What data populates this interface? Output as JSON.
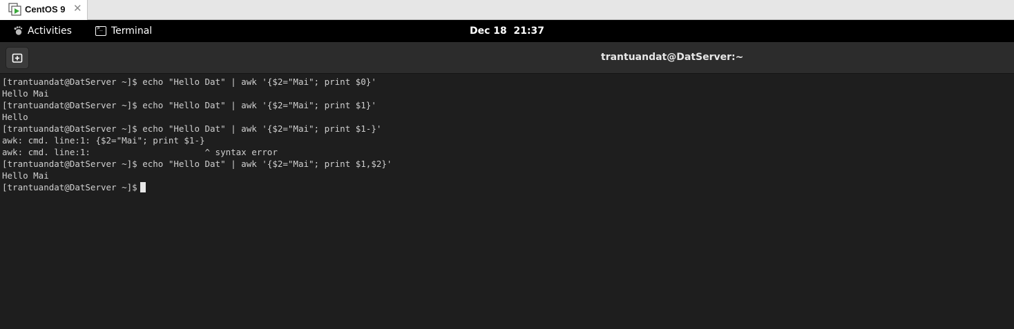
{
  "host": {
    "tab_label": "CentOS 9",
    "close_glyph": "✕"
  },
  "topbar": {
    "activities_label": "Activities",
    "app_label": "Terminal",
    "clock": "Dec 18  21:37"
  },
  "terminal": {
    "title": "trantuandat@DatServer:~",
    "prompt": "[trantuandat@DatServer ~]$",
    "lines": [
      "[trantuandat@DatServer ~]$ echo \"Hello Dat\" | awk '{$2=\"Mai\"; print $0}'",
      "Hello Mai",
      "[trantuandat@DatServer ~]$ echo \"Hello Dat\" | awk '{$2=\"Mai\"; print $1}'",
      "Hello",
      "[trantuandat@DatServer ~]$ echo \"Hello Dat\" | awk '{$2=\"Mai\"; print $1-}'",
      "awk: cmd. line:1: {$2=\"Mai\"; print $1-}",
      "awk: cmd. line:1:                      ^ syntax error",
      "[trantuandat@DatServer ~]$ echo \"Hello Dat\" | awk '{$2=\"Mai\"; print $1,$2}'",
      "Hello Mai"
    ]
  },
  "colors": {
    "terminal_bg": "#1e1e1e",
    "terminal_fg": "#d0d0d0",
    "topbar_bg": "#000000",
    "header_bg": "#2c2c2c"
  },
  "icons": {
    "vm": "vm-window-icon",
    "activities": "gnome-foot-icon",
    "app": "terminal-icon",
    "new_tab": "new-tab-icon"
  }
}
